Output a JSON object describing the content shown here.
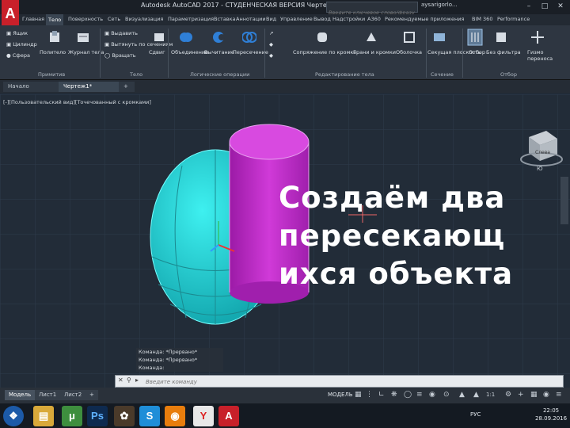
{
  "window": {
    "title": "Autodesk AutoCAD 2017 - СТУДЕНЧЕСКАЯ ВЕРСИЯ   Чертеж1.dwg",
    "search_placeholder": "Введите ключевое слово/фразу",
    "user": "aysarigorlo..."
  },
  "menu": {
    "tabs": [
      "Главная",
      "Тело",
      "Поверхность",
      "Сеть",
      "Визуализация",
      "Параметризация",
      "Вставка",
      "Аннотации",
      "Вид",
      "Управление",
      "Вывод",
      "Надстройки",
      "A360",
      "Рекомендуемые приложения",
      "BIM 360",
      "Performance"
    ]
  },
  "ribbon": {
    "primitives_items": [
      "Ящик",
      "Цилиндр",
      "Сфера"
    ],
    "polysolid_label": "Политело",
    "loft_label": "Журнал тела",
    "extrude_items": [
      "Выдавить",
      "Вытянуть по сечениям",
      "Вращать"
    ],
    "sweep_label": "Сдвиг",
    "union_label": "Объединение",
    "subtract_label": "Вычитание",
    "intersect_label": "Пересечение",
    "fillet_label": "Сопряжение по кромке",
    "slice_label": "Грани и кромки",
    "shell_label": "Оболочка",
    "section_plane_label": "Секущая плоскость",
    "section_label": "Отбор",
    "no_filter_label": "Без фильтра",
    "gizmo_label": "Гизмо переноса",
    "groups": [
      "Примитив",
      "Тело",
      "Логические операции",
      "Редактирование тела",
      "Сечение",
      "Отбор"
    ]
  },
  "doc_tabs": [
    "Начало",
    "Чертеж1*"
  ],
  "viewport": {
    "label": "[-][Пользовательский вид][Точечованный с кромками]",
    "viewcube_face": "Слева",
    "viewcube_compass": "Ю"
  },
  "command": {
    "history": [
      "Команда: *Прервано*",
      "Команда: *Прервано*",
      "Команда:"
    ],
    "input_placeholder": "Введите команду"
  },
  "layout_tabs": [
    "Модель",
    "Лист1",
    "Лист2"
  ],
  "status": {
    "model": "МОДЕЛЬ",
    "scale": "1:1"
  },
  "taskbar": {
    "lang": "РУС",
    "time": "22:05",
    "date": "28.09.2016"
  },
  "overlay": {
    "lines": [
      "Создаём два",
      "пересекающ",
      "ихся объекта"
    ]
  },
  "colors": {
    "sphere": "#2ad8d8",
    "cylinder": "#c028c8",
    "accent_red": "#c8202a"
  }
}
